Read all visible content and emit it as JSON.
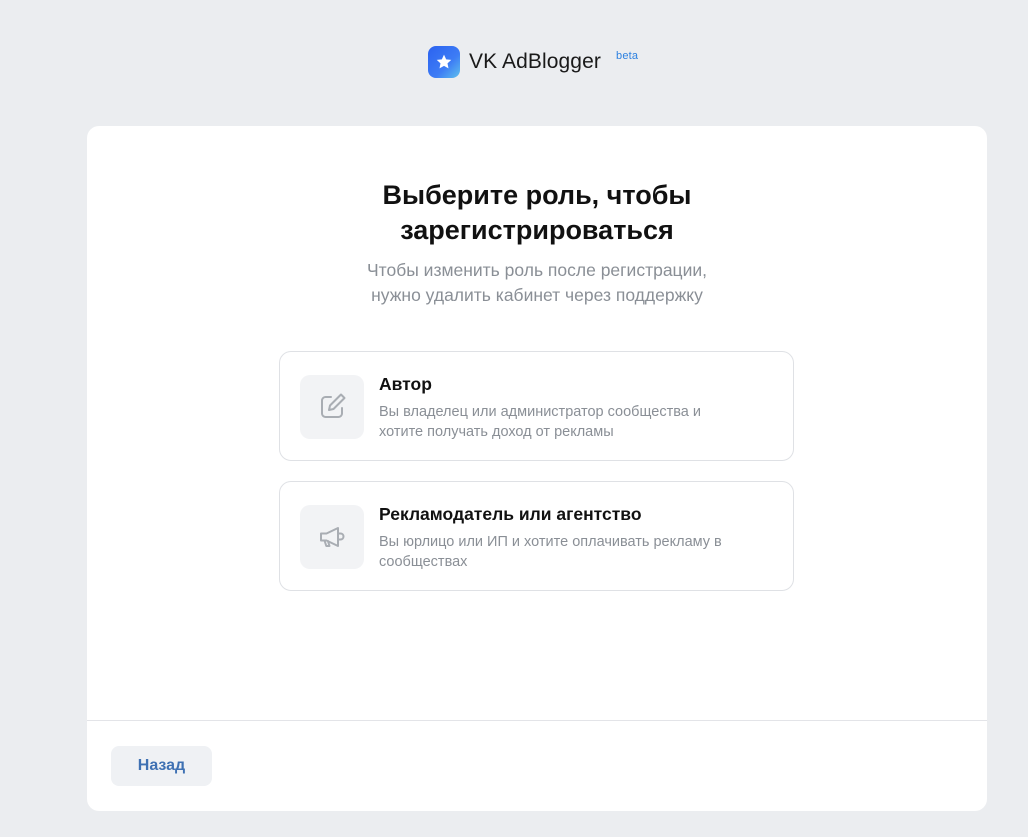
{
  "header": {
    "brand": "VK AdBlogger",
    "badge": "beta",
    "logo_icon": "star-icon"
  },
  "colors": {
    "background": "#ebedf0",
    "accent": "#2d81e0",
    "button_text": "#3f71b3",
    "muted_text": "#8a8f96"
  },
  "main": {
    "title_line1": "Выберите роль, чтобы",
    "title_line2": "зарегистрироваться",
    "subtitle_line1": "Чтобы изменить роль после регистрации,",
    "subtitle_line2": "нужно удалить кабинет через поддержку",
    "options": [
      {
        "icon": "edit-icon",
        "title": "Автор",
        "desc_line1": "Вы владелец или администратор сообщества и",
        "desc_line2": "хотите получать доход от рекламы"
      },
      {
        "icon": "megaphone-icon",
        "title": "Рекламодатель или агентство",
        "desc_line1": "Вы юрлицо или ИП и хотите оплачивать рекламу в",
        "desc_line2": "сообществах"
      }
    ]
  },
  "footer": {
    "back_label": "Назад"
  }
}
